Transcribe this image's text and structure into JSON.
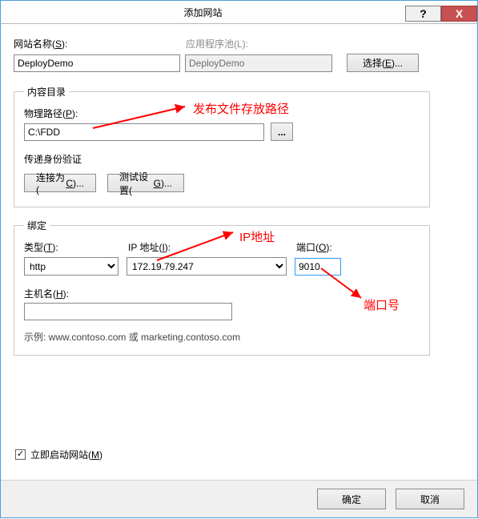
{
  "window": {
    "title": "添加网站",
    "help_symbol": "?",
    "close_symbol": "X"
  },
  "site": {
    "name_label": "网站名称(S):",
    "name_value": "DeployDemo",
    "pool_label": "应用程序池(L):",
    "pool_value": "DeployDemo",
    "select_button": "选择(E)..."
  },
  "content_dir": {
    "group_title": "内容目录",
    "path_label": "物理路径(P):",
    "path_value": "C:\\FDD",
    "browse": "...",
    "passthrough_label": "传递身份验证",
    "connect_button": "连接为(C)...",
    "test_button": "测试设置(G)..."
  },
  "binding": {
    "group_title": "绑定",
    "type_label": "类型(T):",
    "type_value": "http",
    "ip_label": "IP 地址(I):",
    "ip_value": "172.19.79.247",
    "port_label": "端口(O):",
    "port_value": "9010",
    "host_label": "主机名(H):",
    "host_value": "",
    "example": "示例: www.contoso.com 或 marketing.contoso.com"
  },
  "start_site": {
    "label": "立即启动网站(M)",
    "checked": true
  },
  "footer": {
    "ok": "确定",
    "cancel": "取消"
  },
  "annotations": {
    "publish_path": "发布文件存放路径",
    "ip_addr": "IP地址",
    "port_no": "端口号"
  }
}
